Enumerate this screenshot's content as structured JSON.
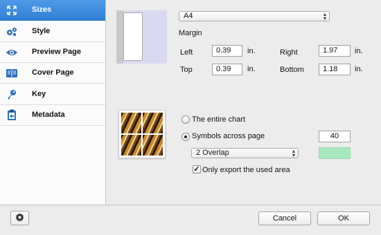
{
  "sidebar": {
    "items": [
      {
        "label": "Sizes",
        "icon": "arrows-expand-icon",
        "active": true
      },
      {
        "label": "Style",
        "icon": "gears-icon"
      },
      {
        "label": "Preview Page",
        "icon": "eye-icon"
      },
      {
        "label": "Cover Page",
        "icon": "book-icon"
      },
      {
        "label": "Key",
        "icon": "key-icon"
      },
      {
        "label": "Metadata",
        "icon": "clipboard-icon"
      }
    ]
  },
  "page": {
    "paper_size": "A4",
    "margin_title": "Margin",
    "left_label": "Left",
    "left_value": "0.39",
    "left_unit": "in.",
    "right_label": "Right",
    "right_value": "1.97",
    "right_unit": "in.",
    "top_label": "Top",
    "top_value": "0.39",
    "top_unit": "in.",
    "bottom_label": "Bottom",
    "bottom_value": "1.18",
    "bottom_unit": "in."
  },
  "export": {
    "option_entire": "The entire chart",
    "option_symbols": "Symbols across page",
    "selected_option": "symbols",
    "symbols_count": "40",
    "overlap_value": "2 Overlap",
    "overlap_color": "#a8e8c0",
    "only_used_area_label": "Only export the used area",
    "only_used_area_checked": true
  },
  "footer": {
    "cancel_label": "Cancel",
    "ok_label": "OK",
    "settings_icon": "gear-icon"
  }
}
